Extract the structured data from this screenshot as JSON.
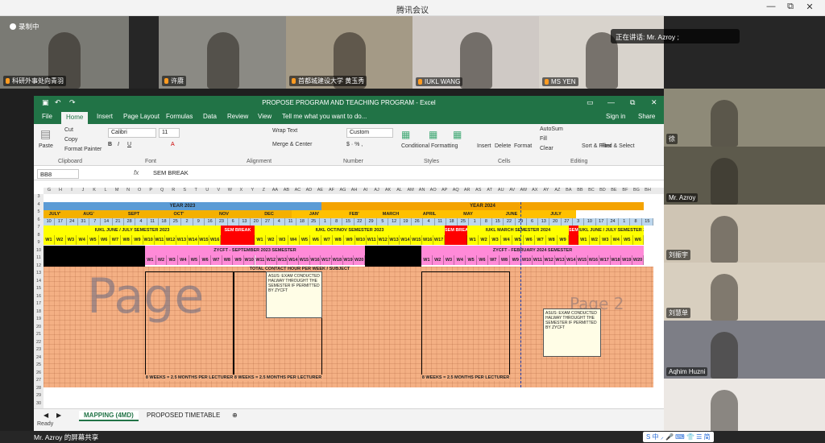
{
  "app": {
    "title": "腾讯会议",
    "win_min": "—",
    "win_max": "⧉",
    "win_close": "✕"
  },
  "recording": "录制中",
  "speaking": "正在讲话: Mr. Azroy ;",
  "video_strip": [
    {
      "name": "科研外事处向青羽",
      "bg": "#7a7a74"
    },
    {
      "name": "许赓",
      "bg": "#8b8a84"
    },
    {
      "name": "首都城建设大学 黄玉秀",
      "bg": "#a49a86"
    },
    {
      "name": "IUKL WANG",
      "bg": "#cfc9c5"
    },
    {
      "name": "MS YEN",
      "bg": "#d8d3cc"
    }
  ],
  "sidebar_tiles": [
    {
      "name": "徐",
      "bg": "#8e8a78"
    },
    {
      "name": "Mr. Azroy",
      "bg": "#5d5a4c"
    },
    {
      "name": "刘振宇",
      "bg": "#cfc5b4"
    },
    {
      "name": "刘慧单",
      "bg": "#d8cfbf"
    },
    {
      "name": "Aqhim Huzni",
      "bg": "#7d7e86"
    },
    {
      "name": "",
      "bg": "#ece8e4"
    }
  ],
  "excel": {
    "title": "PROPOSE PROGRAM AND TEACHING PROGRAM - Excel",
    "tabs": [
      "File",
      "Home",
      "Insert",
      "Page Layout",
      "Formulas",
      "Data",
      "Review",
      "View"
    ],
    "tell_me": "Tell me what you want to do...",
    "sign_in": "Sign in",
    "share": "Share",
    "clipboard": {
      "paste": "Paste",
      "cut": "Cut",
      "copy": "Copy",
      "format_painter": "Format Painter",
      "group": "Clipboard"
    },
    "font": {
      "name": "Calibri",
      "size": "11",
      "group": "Font"
    },
    "alignment": {
      "wrap": "Wrap Text",
      "merge": "Merge & Center",
      "group": "Alignment"
    },
    "number": {
      "format": "Custom",
      "group": "Number"
    },
    "styles": {
      "conditional": "Conditional Formatting",
      "format_table": "Format as Table",
      "cell_styles": "Cell Styles",
      "group": "Styles"
    },
    "cells": {
      "insert": "Insert",
      "delete": "Delete",
      "format": "Format",
      "group": "Cells"
    },
    "editing": {
      "autosum": "AutoSum",
      "fill": "Fill",
      "clear": "Clear",
      "sort": "Sort & Filter",
      "find": "Find & Select",
      "group": "Editing"
    },
    "name_box": "BB8",
    "formula": "SEM BREAK",
    "columns": [
      "G",
      "H",
      "I",
      "J",
      "K",
      "L",
      "M",
      "N",
      "O",
      "P",
      "Q",
      "R",
      "S",
      "T",
      "U",
      "V",
      "W",
      "X",
      "Y",
      "Z",
      "AA",
      "AB",
      "AC",
      "AD",
      "AE",
      "AF",
      "AG",
      "AH",
      "AI",
      "AJ",
      "AK",
      "AL",
      "AM",
      "AN",
      "AO",
      "AP",
      "AQ",
      "AR",
      "AS",
      "AT",
      "AU",
      "AV",
      "AW",
      "AX",
      "AY",
      "AZ",
      "BA",
      "BB",
      "BC",
      "BD",
      "BE",
      "BF",
      "BG",
      "BH"
    ],
    "rows": [
      "3",
      "4",
      "5",
      "6",
      "7",
      "8",
      "9",
      "10",
      "11",
      "12",
      "13",
      "14",
      "15",
      "16",
      "17",
      "18",
      "19",
      "20",
      "21",
      "22",
      "23",
      "24",
      "25",
      "26",
      "27",
      "28",
      "29",
      "30"
    ],
    "year_2023": "YEAR 2023",
    "year_2024": "YEAR 2024",
    "months": [
      "JULY'",
      "AUG'",
      "SEPT",
      "OCT'",
      "NOV",
      "DEC",
      "JAN'",
      "FEB'",
      "MARCH",
      "APRIL",
      "MAY",
      "JUNE",
      "JULY"
    ],
    "dates": [
      "10",
      "17",
      "24",
      "31",
      "7",
      "14",
      "21",
      "28",
      "4",
      "11",
      "18",
      "25",
      "2",
      "9",
      "16",
      "23",
      "6",
      "13",
      "20",
      "27",
      "4",
      "11",
      "18",
      "25",
      "1",
      "8",
      "15",
      "22",
      "29",
      "5",
      "12",
      "19",
      "26",
      "4",
      "11",
      "18",
      "25",
      "1",
      "8",
      "15",
      "22",
      "29",
      "6",
      "13",
      "20",
      "27",
      "3",
      "10",
      "17",
      "24",
      "1",
      "8",
      "15"
    ],
    "sem_jul": "IUKL JUNE / JULY SEMESTER 2023",
    "sem_break": "SEM BREAK",
    "sem_oct": "IUKL OCT/NOV SEMESTER 2023",
    "sem_break2": "SEM BREAK",
    "sem_mar": "IUKL MARCH SEMESTER 2024",
    "sem_june": "IUKL JUNE / JULY SEMESTER 2",
    "sem_br3": "SEM BR",
    "weeks_a": [
      "W1",
      "W2",
      "W3",
      "W4",
      "W5",
      "W6",
      "W7",
      "W8",
      "W9",
      "W10",
      "W11",
      "W12",
      "W13",
      "W14",
      "W15",
      "W16"
    ],
    "weeks_b": [
      "W1",
      "W2",
      "W3",
      "W4",
      "W5",
      "W6",
      "W7",
      "W8",
      "W9",
      "W10",
      "W11",
      "W12",
      "W13",
      "W14",
      "W15",
      "W16",
      "W17"
    ],
    "weeks_c": [
      "W1",
      "W2",
      "W3",
      "W4",
      "W5",
      "W6",
      "W7",
      "W8",
      "W9"
    ],
    "weeks_d": [
      "W1",
      "W2",
      "W3",
      "W4",
      "W5",
      "W6"
    ],
    "zyc_sep": "ZYCFT - SEPTEMBER 2023 SEMESTER",
    "zyc_feb": "ZYCFT - FEBRUARY 2024 SEMESTER",
    "weeks20": [
      "W1",
      "W2",
      "W3",
      "W4",
      "W5",
      "W6",
      "W7",
      "W8",
      "W9",
      "W10",
      "W11",
      "W12",
      "W13",
      "W14",
      "W15",
      "W16",
      "W17",
      "W18",
      "W19",
      "W20"
    ],
    "contact_hdr": "TOTAL CONTACT HOUR PER WEEK / SUBJECT",
    "note1": "ASUS: EXAM CONDUCTED HALWAY THROUGHT THE SEMESTER IF PERMITTED BY ZYCFT",
    "note2": "ASUS: EXAM CONDUCTED HALWAY THROUGHT THE SEMESTER IF PERMITTED BY ZYCFT",
    "weeks_foot": "8 WEEKS = 2.5 MONTHS PER LECTURER",
    "wm1": "Page",
    "wm2": "Page 2",
    "sheets": [
      "MAPPING (4MD)",
      "PROPOSED TIMETABLE"
    ],
    "status": "Ready"
  },
  "share_label": "Mr. Azroy 的屏幕共享",
  "tray": "S 中 ⸝ 🎤 ⌨ 👕 ☰ 简"
}
